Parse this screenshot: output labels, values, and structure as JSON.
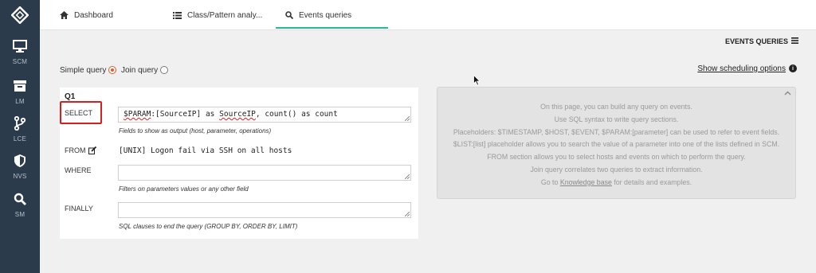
{
  "sidebar": {
    "items": [
      {
        "label": "SCM",
        "icon": "monitor-icon"
      },
      {
        "label": "LM",
        "icon": "archive-box-icon"
      },
      {
        "label": "LCE",
        "icon": "branch-icon"
      },
      {
        "label": "NVS",
        "icon": "shield-icon"
      },
      {
        "label": "SM",
        "icon": "search-icon"
      }
    ]
  },
  "tabs": [
    {
      "label": "Dashboard",
      "icon": "home-icon"
    },
    {
      "label": "Class/Pattern analy...",
      "icon": "list-icon"
    },
    {
      "label": "Events queries",
      "icon": "search-icon"
    }
  ],
  "header": {
    "menu_label": "EVENTS QUERIES"
  },
  "query_mode": {
    "simple_label": "Simple query",
    "join_label": "Join query",
    "selected": "simple"
  },
  "scheduling_link": "Show scheduling options",
  "query": {
    "title": "Q1",
    "select": {
      "label": "SELECT",
      "value_param": "$PARAM",
      "value_mid": ":[SourceIP] as ",
      "value_alias": "SourceIP",
      "value_rest": ", count() as count",
      "hint": "Fields to show as output (host, parameter, operations)"
    },
    "from": {
      "label": "FROM",
      "value": "[UNIX] Logon fail via SSH on all hosts"
    },
    "where": {
      "label": "WHERE",
      "value": "",
      "hint": "Filters on parameters values or any other field"
    },
    "finally": {
      "label": "FINALLY",
      "value": "",
      "hint": "SQL clauses to end the query (GROUP BY, ORDER BY, LIMIT)"
    }
  },
  "info": {
    "line1": "On this page, you can build any query on events.",
    "line2": "Use SQL syntax to write query sections.",
    "line3": "Placeholders: $TIMESTAMP, $HOST, $EVENT, $PARAM:[parameter] can be used to refer to event fields.",
    "line4": "$LIST:[list] placeholder allows you to search the value of a parameter into one of the lists defined in SCM.",
    "line5": "FROM section allows you to select hosts and events on which to perform the query.",
    "line6": "Join query correlates two queries to extract information.",
    "line7_pre": "Go to ",
    "line7_link": "Knowledge base",
    "line7_post": " for details and examples."
  },
  "colors": {
    "sidebar_bg": "#2c3b4b",
    "tab_active": "#26b89a",
    "radio_on": "#e05a2b",
    "highlight_box": "#d62020"
  }
}
